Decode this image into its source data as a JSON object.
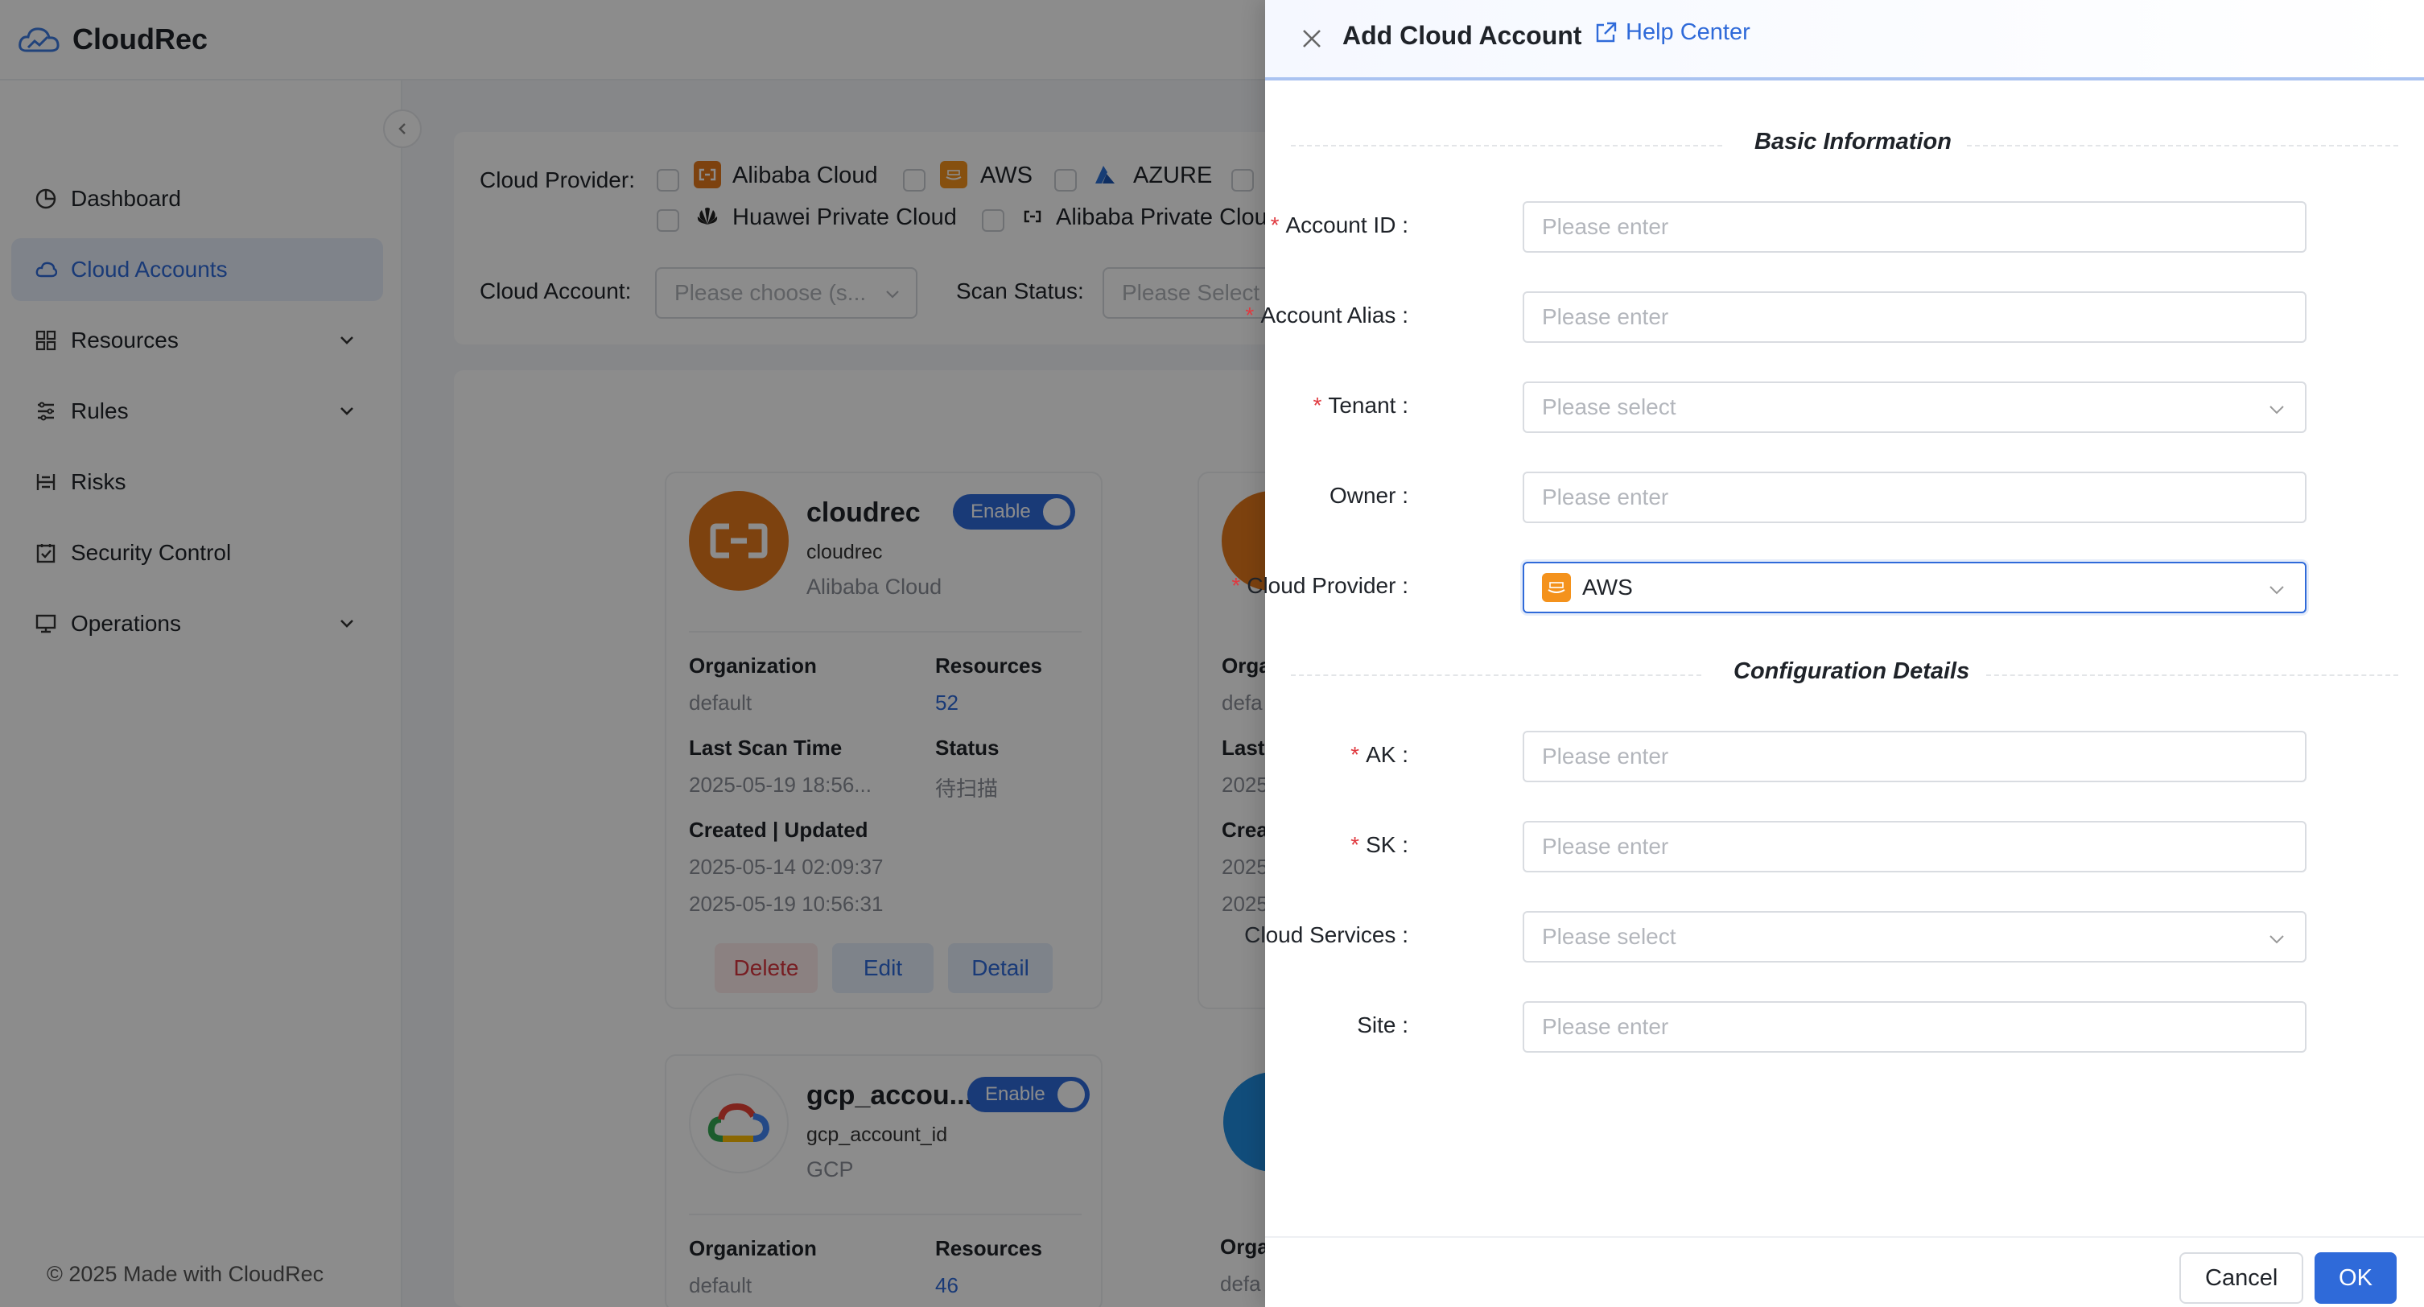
{
  "app": {
    "name": "CloudRec"
  },
  "sidebar": {
    "items": [
      {
        "label": "Dashboard",
        "icon": "dashboard-icon"
      },
      {
        "label": "Cloud Accounts",
        "icon": "cloud-icon",
        "active": true
      },
      {
        "label": "Resources",
        "icon": "grid-icon",
        "expandable": true
      },
      {
        "label": "Rules",
        "icon": "rules-icon",
        "expandable": true
      },
      {
        "label": "Risks",
        "icon": "risks-icon"
      },
      {
        "label": "Security Control",
        "icon": "security-icon"
      },
      {
        "label": "Operations",
        "icon": "monitor-icon",
        "expandable": true
      }
    ],
    "footer": "© 2025 Made with CloudRec"
  },
  "filters": {
    "cloud_provider_label": "Cloud Provider",
    "providers": [
      "Alibaba Cloud",
      "AWS",
      "AZURE",
      "Huawei Private Cloud",
      "Alibaba Private Clou"
    ],
    "cloud_account_label": "Cloud Account",
    "cloud_account_placeholder": "Please choose (s...",
    "scan_status_label": "Scan Status",
    "scan_status_placeholder": "Please Select"
  },
  "cards": [
    {
      "name": "cloudrec",
      "id": "cloudrec",
      "provider": "Alibaba Cloud",
      "toggle": "Enable",
      "org_label": "Organization",
      "org": "default",
      "resources_label": "Resources",
      "resources": "52",
      "last_scan_label": "Last Scan Time",
      "last_scan": "2025-05-19 18:56...",
      "status_label": "Status",
      "status": "待扫描",
      "created_label": "Created | Updated",
      "created": "2025-05-14 02:09:37",
      "updated": "2025-05-19 10:56:31",
      "delete": "Delete",
      "edit": "Edit",
      "detail": "Detail"
    },
    {
      "name": "gcp_accou...",
      "id": "gcp_account_id",
      "provider": "GCP",
      "toggle": "Enable",
      "org_label": "Organization",
      "org": "default",
      "resources_label": "Resources",
      "resources": "46"
    }
  ],
  "partial_card": {
    "org_label": "Orga",
    "org": "defa",
    "last_label": "Last",
    "last": "2025",
    "created_label": "Crea",
    "created": "2025",
    "updated": "2025"
  },
  "drawer": {
    "title": "Add Cloud Account",
    "help": "Help Center",
    "sections": {
      "basic": "Basic Information",
      "config": "Configuration Details"
    },
    "fields": {
      "account_id": {
        "label": "Account ID",
        "placeholder": "Please enter"
      },
      "account_alias": {
        "label": "Account Alias",
        "placeholder": "Please enter"
      },
      "tenant": {
        "label": "Tenant",
        "placeholder": "Please select"
      },
      "owner": {
        "label": "Owner",
        "placeholder": "Please enter"
      },
      "cloud_provider": {
        "label": "Cloud Provider",
        "value": "AWS"
      },
      "ak": {
        "label": "AK",
        "placeholder": "Please enter"
      },
      "sk": {
        "label": "SK",
        "placeholder": "Please enter"
      },
      "cloud_services": {
        "label": "Cloud Services",
        "placeholder": "Please select"
      },
      "site": {
        "label": "Site",
        "placeholder": "Please enter"
      }
    },
    "cancel": "Cancel",
    "ok": "OK"
  },
  "colors": {
    "primary": "#2f6ad9",
    "required": "#e0393f",
    "aws": "#f4921c",
    "alibaba": "#e3781c"
  }
}
